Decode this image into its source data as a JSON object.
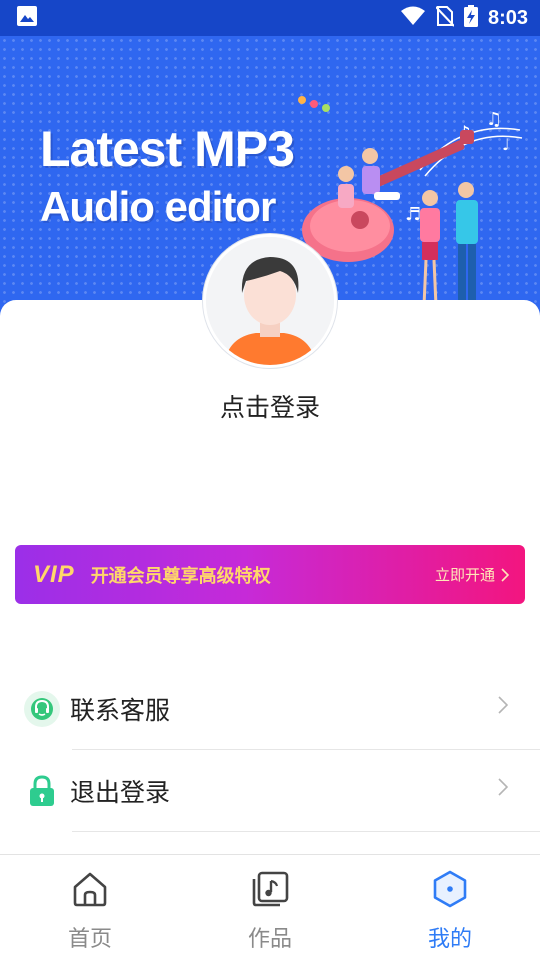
{
  "status_bar": {
    "time": "8:03"
  },
  "banner": {
    "title_line1": "Latest MP3",
    "title_line2": "Audio editor"
  },
  "profile": {
    "login_prompt": "点击登录"
  },
  "vip_banner": {
    "logo": "VIP",
    "text": "开通会员尊享高级特权",
    "cta": "立即开通"
  },
  "menu": {
    "items": [
      {
        "label": "联系客服",
        "icon": "customer-service-icon"
      },
      {
        "label": "退出登录",
        "icon": "lock-icon"
      }
    ]
  },
  "bottom_nav": {
    "items": [
      {
        "label": "首页",
        "icon": "home-icon"
      },
      {
        "label": "作品",
        "icon": "works-icon"
      },
      {
        "label": "我的",
        "icon": "profile-hex-icon",
        "active": true
      }
    ]
  },
  "colors": {
    "status_bar": "#1646c8",
    "banner": "#2f67f0",
    "vip_start": "#9b2fe8",
    "vip_end": "#f3157f",
    "vip_text": "#ffd76a",
    "active_tab": "#2f7cf6",
    "inactive_tab": "#8a8a8a",
    "service_icon": "#34c77b",
    "lock_icon": "#2ecc8f"
  }
}
